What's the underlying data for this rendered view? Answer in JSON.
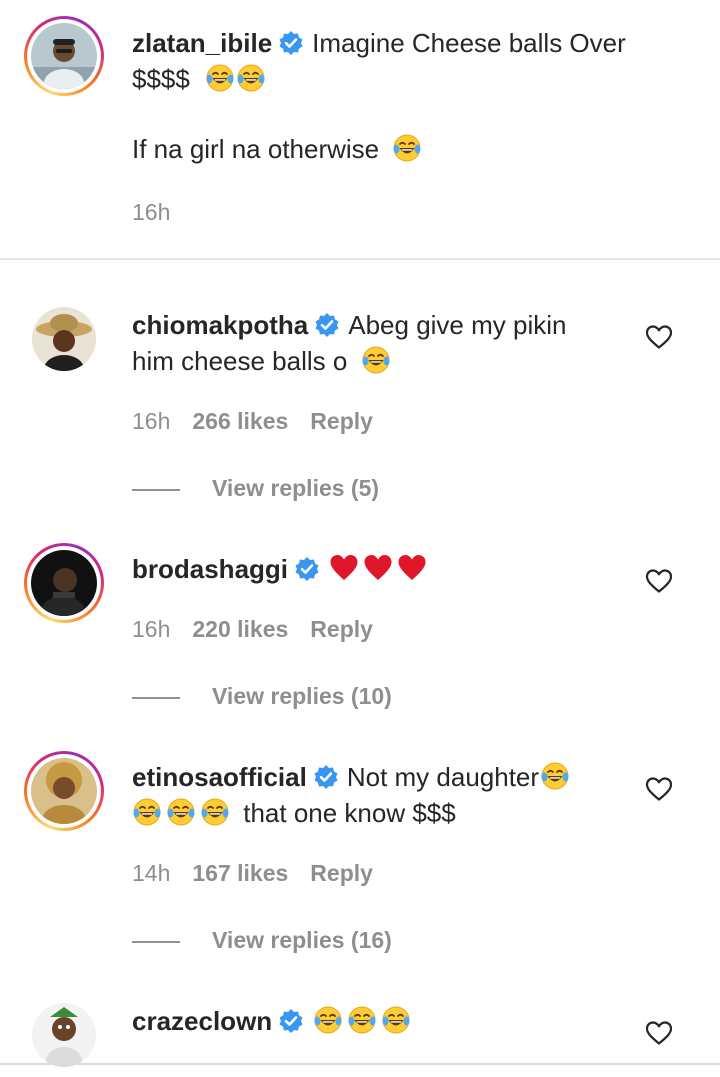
{
  "caption": {
    "username": "zlatan_ibile",
    "text_line1": "Imagine Cheese balls Over",
    "text_line2": "$$$$",
    "paragraph2": "If na girl na otherwise",
    "time": "16h"
  },
  "comments": [
    {
      "username": "chiomakpotha",
      "text_a": "Abeg give my pikin",
      "text_b": "him cheese balls o",
      "time": "16h",
      "likes": "266 likes",
      "reply": "Reply",
      "view_replies": "View replies (5)"
    },
    {
      "username": "brodashaggi",
      "time": "16h",
      "likes": "220 likes",
      "reply": "Reply",
      "view_replies": "View replies (10)"
    },
    {
      "username": "etinosaofficial",
      "text_a": "Not my daughter",
      "text_b": "that one know $$$",
      "time": "14h",
      "likes": "167 likes",
      "reply": "Reply",
      "view_replies": "View replies (16)"
    },
    {
      "username": "crazeclown"
    }
  ],
  "colors": {
    "verified_blue": "#3897f0",
    "meta_gray": "#8e8e8e",
    "heart_red": "#e0162b",
    "text": "#262626"
  },
  "icons": [
    "verified-badge-icon",
    "heart-outline-icon",
    "laughing-crying-emoji",
    "red-heart-emoji"
  ]
}
